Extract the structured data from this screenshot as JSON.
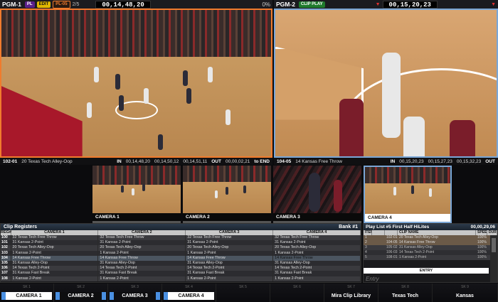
{
  "pgm_left": {
    "name": "PGM-1",
    "pill_pl": "PL",
    "pill_edit": "EDIT",
    "pill_playlist": "PL-05",
    "count": "2/5",
    "timecode": "00,14,48,20",
    "percent": "0%",
    "clip_id": "102-01",
    "clip_name": "20 Texas Tech Alley-Oop",
    "in_label": "IN",
    "in_tc": "00,14,48,20",
    "mid_tc": "00,14,50,12",
    "out_tc": "00,14,51,11",
    "out_label": "OUT",
    "remain_tc": "00,00,02,21",
    "to_end": "to END"
  },
  "pgm_right": {
    "name": "PGM-2",
    "pill_clip": "CLIP PLAY",
    "timecode": "00,15,20,23",
    "clip_id": "104-05",
    "clip_name": "14 Kansas Free Throw",
    "in_label": "IN",
    "in_tc": "00,15,20,23",
    "mid_tc": "00,15,27,23",
    "out_tc": "00,15,32,23",
    "out_label": "OUT"
  },
  "cameras": [
    "CAMERA 1",
    "CAMERA 2",
    "CAMERA 3",
    "CAMERA 4"
  ],
  "registers": {
    "title": "Clip Registers",
    "bank": "Bank #1",
    "headers": [
      "REG#",
      "CAMERA 1",
      "CAMERA 2",
      "CAMERA 3",
      "CAMERA 4"
    ],
    "rows": [
      [
        "100",
        "32 Texas Tech Free Throw",
        "32 Texas Tech Free Throw",
        "32 Texas Tech Free Throw",
        "32 Texas Tech Free Throw"
      ],
      [
        "101",
        "31 Kansas 2-Point",
        "31 Kansas 2-Point",
        "31 Kansas 2-Point",
        "31 Kansas 2-Point"
      ],
      [
        "102",
        "20 Texas Tech Alley-Oop",
        "20 Texas Tech Alley-Oop",
        "20 Texas Tech Alley-Oop",
        "20 Texas Tech Alley-Oop"
      ],
      [
        "103",
        "1 Kansas 2-Point",
        "1 Kansas 2-Point",
        "1 Kansas 2-Point",
        "1 Kansas 2-Point"
      ],
      [
        "104",
        "14 Kansas Free Throw",
        "14 Kansas Free Throw",
        "14 Kansas Free Throw",
        "14 Kansas Free Throw"
      ],
      [
        "105",
        "31 Kansas Alley-Oop",
        "31 Kansas Alley-Oop",
        "31 Kansas Alley-Oop",
        "31 Kansas Alley-Oop"
      ],
      [
        "106",
        "14 Texas Tech 2-Point",
        "14 Texas Tech 2-Point",
        "14 Texas Tech 2-Point",
        "14 Texas Tech 2-Point"
      ],
      [
        "107",
        "31 Kansas Fast Break",
        "31 Kansas Fast Break",
        "31 Kansas Fast Break",
        "31 Kansas Fast Break"
      ],
      [
        "108",
        "1 Kansas 2-Point",
        "1 Kansas 2-Point",
        "1 Kansas 2-Point",
        "1 Kansas 2-Point"
      ]
    ]
  },
  "playlist": {
    "title": "Play List #5 First Half HiLites",
    "duration": "00,00,29,06",
    "headers": [
      "ITEM",
      "",
      "",
      "CLIP NAME",
      "SPEED",
      "DUR"
    ],
    "rows": [
      [
        "1",
        "",
        "102-01",
        "20 Texas Tech Alley-Oop",
        "100%",
        ""
      ],
      [
        "2",
        "",
        "104-05",
        "14 Kansas Free Throw",
        "100%",
        ""
      ],
      [
        "3",
        "",
        "105-02",
        "31 Kansas Alley-Oop",
        "100%",
        ""
      ],
      [
        "4",
        "",
        "106-03",
        "14 Texas Tech 2-Point",
        "100%",
        ""
      ],
      [
        "5",
        "",
        "108-01",
        "1 Kansas 2-Point",
        "100%",
        ""
      ]
    ],
    "entry_bar": "ENTRY",
    "entry_placeholder": "Entry"
  },
  "bottom": {
    "sk_labels": [
      "SK 1",
      "SK 2",
      "SK 3",
      "SK 4",
      "SK 5",
      "SK 6",
      "SK 7",
      "SK 8",
      "SK 9"
    ],
    "cam_buttons": [
      "CAMERA 1",
      "CAMERA 2",
      "CAMERA 3",
      "CAMERA 4"
    ],
    "library": "Mira Clip Library",
    "team1": "Texas Tech",
    "team2": "Kansas"
  }
}
